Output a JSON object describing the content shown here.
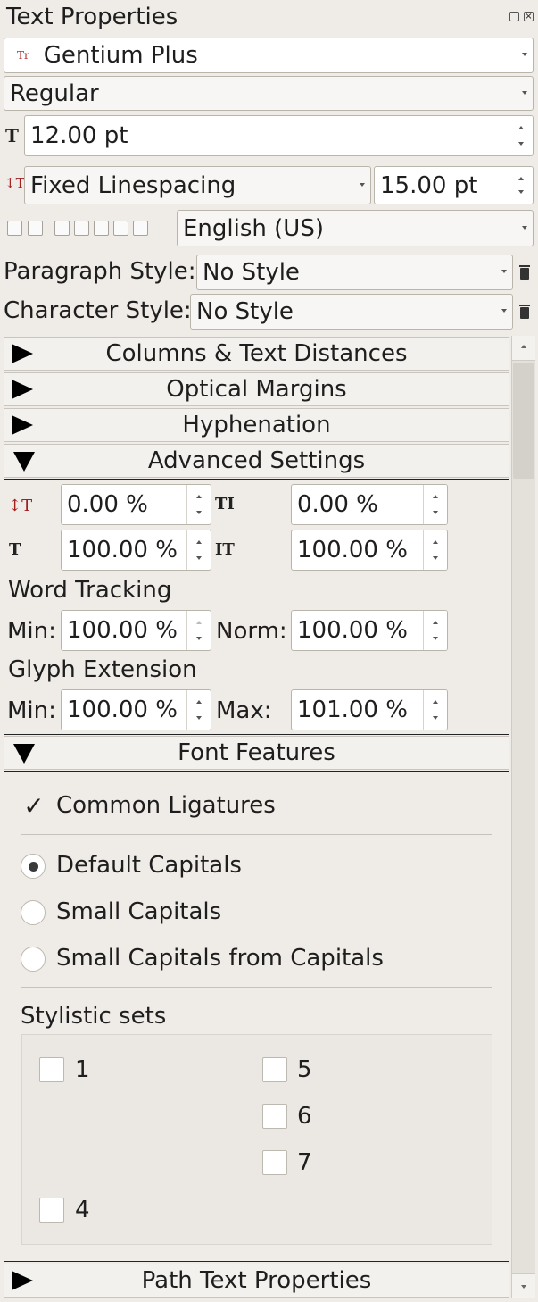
{
  "panel": {
    "title": "Text Properties",
    "font_family": "Gentium Plus",
    "font_style": "Regular",
    "font_size": "12.00 pt",
    "linespacing_mode": "Fixed Linespacing",
    "linespacing_value": "15.00 pt",
    "language": "English (US)",
    "paragraph_style_label": "Paragraph Style:",
    "paragraph_style_value": "No Style",
    "character_style_label": "Character Style:",
    "character_style_value": "No Style"
  },
  "sections": {
    "columns": "Columns & Text Distances",
    "optical": "Optical Margins",
    "hyphenation": "Hyphenation",
    "advanced": "Advanced Settings",
    "font_features": "Font Features",
    "path_text": "Path Text Properties"
  },
  "advanced": {
    "baseline_offset": "0.00 %",
    "tracking": "0.00 %",
    "scale_width": "100.00 %",
    "scale_height": "100.00 %",
    "word_tracking_title": "Word Tracking",
    "word_min_label": "Min:",
    "word_min_value": "100.00 %",
    "word_norm_label": "Norm:",
    "word_norm_value": "100.00 %",
    "glyph_title": "Glyph Extension",
    "glyph_min_label": "Min:",
    "glyph_min_value": "100.00 %",
    "glyph_max_label": "Max:",
    "glyph_max_value": "101.00 %"
  },
  "font_features": {
    "common_ligatures": "Common Ligatures",
    "common_ligatures_checked": true,
    "capitals_options": [
      "Default Capitals",
      "Small Capitals",
      "Small Capitals from Capitals"
    ],
    "capitals_selected": "Default Capitals",
    "stylistic_title": "Stylistic sets",
    "sets": [
      "1",
      "5",
      "6",
      "7",
      "4"
    ]
  },
  "icons": {
    "checkmark": "✓"
  }
}
